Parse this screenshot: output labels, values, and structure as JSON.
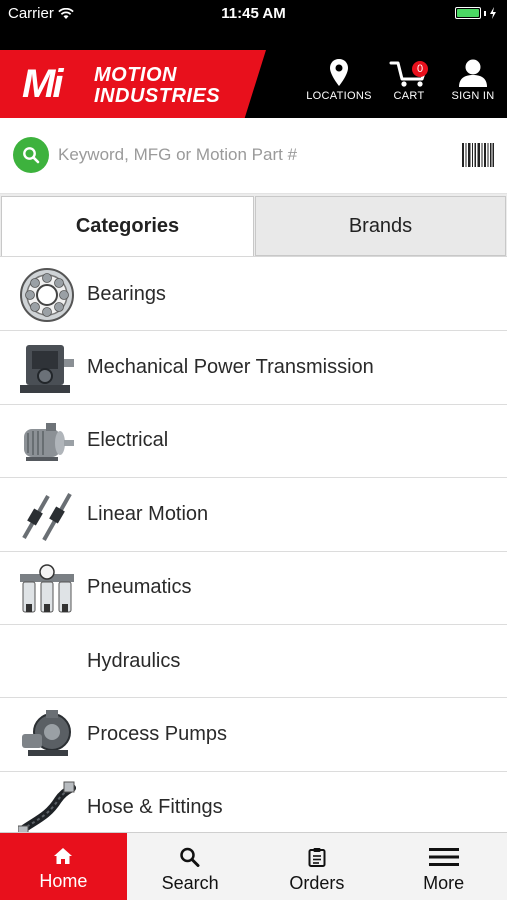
{
  "status_bar": {
    "carrier": "Carrier",
    "time": "11:45 AM"
  },
  "brand": {
    "logo_mark": "Mi",
    "logo_line1": "MOTION",
    "logo_line2": "INDUSTRIES",
    "accent_color": "#e8101c"
  },
  "header": {
    "locations_label": "LOCATIONS",
    "cart_label": "CART",
    "cart_count": "0",
    "sign_in_label": "SIGN IN"
  },
  "search": {
    "placeholder": "Keyword, MFG or Motion Part #"
  },
  "tabs": {
    "categories": "Categories",
    "brands": "Brands",
    "active": "categories"
  },
  "categories": [
    {
      "label": "Bearings",
      "icon": "bearing-icon"
    },
    {
      "label": "Mechanical Power Transmission",
      "icon": "gearbox-icon"
    },
    {
      "label": "Electrical",
      "icon": "motor-icon"
    },
    {
      "label": "Linear Motion",
      "icon": "linear-rail-icon"
    },
    {
      "label": "Pneumatics",
      "icon": "air-filter-icon"
    },
    {
      "label": "Hydraulics",
      "icon": ""
    },
    {
      "label": "Process Pumps",
      "icon": "pump-icon"
    },
    {
      "label": "Hose & Fittings",
      "icon": "hose-icon"
    }
  ],
  "tabbar": {
    "home": "Home",
    "search": "Search",
    "orders": "Orders",
    "more": "More",
    "active": "home"
  }
}
